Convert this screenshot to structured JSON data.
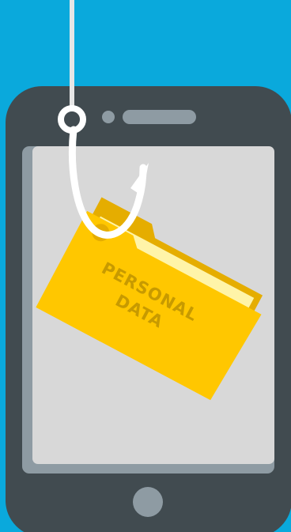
{
  "illustration": {
    "folder_label_line1": "PERSONAL",
    "folder_label_line2": "DATA",
    "icons": {
      "hook": "fishing-hook-icon",
      "phone": "smartphone-icon",
      "folder": "folder-icon",
      "home_button": "home-button-icon"
    },
    "colors": {
      "background": "#0aa9dc",
      "phone_body": "#414b50",
      "screen": "#d8d8d8",
      "screen_shadow": "#8e9ba3",
      "hook": "#ffffff",
      "line": "#e6e6e6",
      "folder_front": "#ffc700",
      "folder_back": "#e5ad00",
      "folder_paper": "#fff4a8",
      "folder_text": "#c79a00",
      "home_button": "#8e9ba3"
    }
  }
}
